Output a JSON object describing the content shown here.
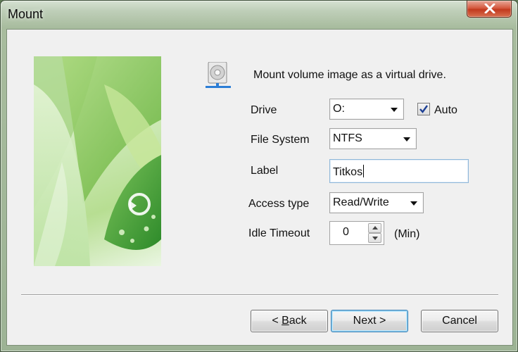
{
  "window": {
    "title": "Mount"
  },
  "intro_text": "Mount volume image as a virtual drive.",
  "icons": {
    "close": "close-icon",
    "disk": "disk-icon",
    "check": "checkmark-icon"
  },
  "fields": {
    "drive": {
      "label": "Drive",
      "value": "O:",
      "auto_label": "Auto",
      "auto_checked": true
    },
    "file_system": {
      "label": "File System",
      "value": "NTFS"
    },
    "volume_label": {
      "label": "Label",
      "value": "Titkos"
    },
    "access_type": {
      "label": "Access type",
      "value": "Read/Write"
    },
    "idle_timeout": {
      "label": "Idle Timeout",
      "value": "0",
      "unit": "(Min)"
    }
  },
  "buttons": {
    "back": {
      "prefix": "< ",
      "accel": "B",
      "rest": "ack"
    },
    "next": "Next >",
    "cancel": "Cancel"
  },
  "colors": {
    "close_red": "#c13a1e",
    "default_button_border": "#3c7fb1"
  }
}
